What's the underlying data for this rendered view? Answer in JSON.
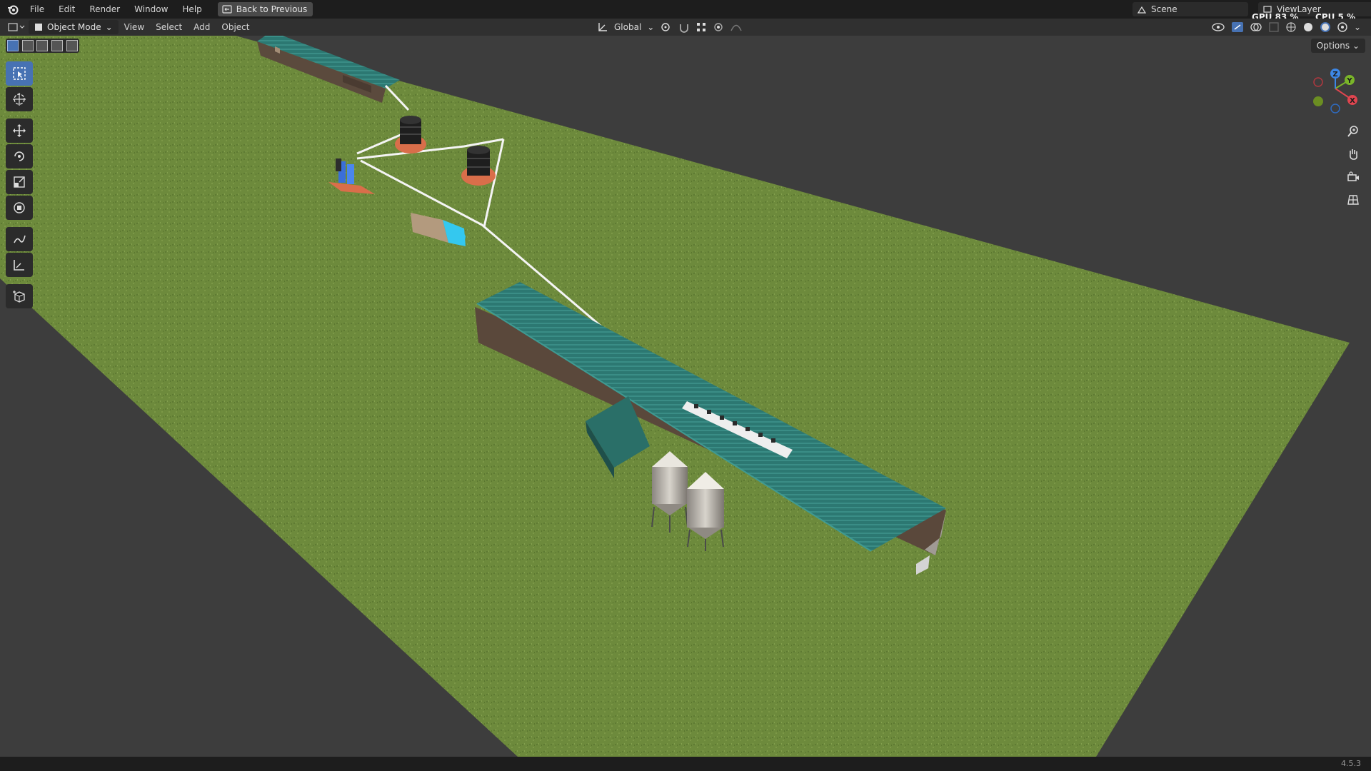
{
  "app": {
    "menu": [
      "File",
      "Edit",
      "Render",
      "Window",
      "Help"
    ],
    "back_button_label": "Back to Previous",
    "scene_label": "Scene",
    "view_layer_label": "ViewLayer",
    "gpu_label": "GPU",
    "gpu_value": "83 %",
    "cpu_label": "CPU",
    "cpu_value": "5 %",
    "version": "4.5.3"
  },
  "header": {
    "mode_label": "Object Mode",
    "menus": [
      "View",
      "Select",
      "Add",
      "Object"
    ],
    "transform_orientation": "Global",
    "options_label": "Options"
  },
  "gizmo": {
    "axes": [
      "X",
      "Y",
      "Z"
    ],
    "colors": {
      "x": "#e0454f",
      "y": "#7ab529",
      "z": "#3d87e6"
    }
  },
  "toolbar": {
    "tools": [
      "select-box",
      "cursor",
      "move",
      "rotate",
      "scale",
      "transform",
      "annotate",
      "measure",
      "add-cube"
    ],
    "active": "select-box"
  },
  "colors": {
    "accent": "#4772b3",
    "grass": "#6e8a3d",
    "roof": "#2f7a72",
    "pipe": "#ffffff",
    "water_tank_base": "#e07b57",
    "pool": "#34c8ef"
  }
}
